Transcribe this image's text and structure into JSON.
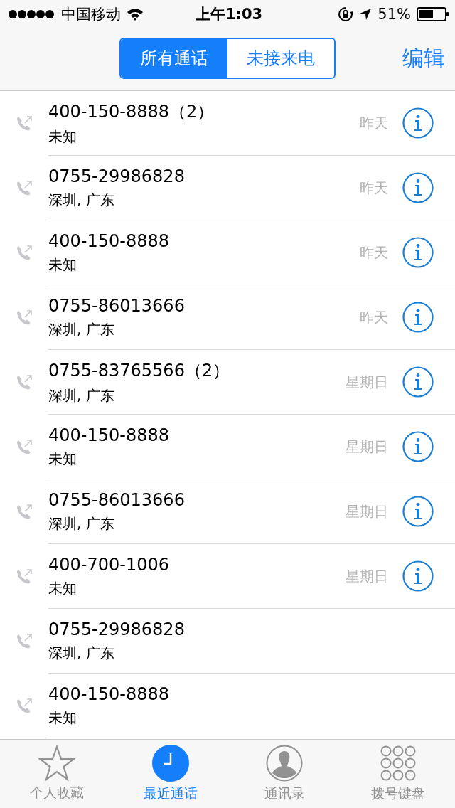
{
  "status_bar": {
    "carrier": "中国移动",
    "time": "上午1:03",
    "battery": "51%"
  },
  "nav": {
    "segments": [
      {
        "label": "所有通话",
        "selected": true
      },
      {
        "label": "未接来电",
        "selected": false
      }
    ],
    "edit": "编辑"
  },
  "calls": [
    {
      "number": "400-150-8888（2）",
      "location": "未知",
      "date": "昨天"
    },
    {
      "number": "0755-29986828",
      "location": "深圳, 广东",
      "date": "昨天"
    },
    {
      "number": "400-150-8888",
      "location": "未知",
      "date": "昨天"
    },
    {
      "number": "0755-86013666",
      "location": "深圳, 广东",
      "date": "昨天"
    },
    {
      "number": "0755-83765566（2）",
      "location": "深圳, 广东",
      "date": "星期日"
    },
    {
      "number": "400-150-8888",
      "location": "未知",
      "date": "星期日"
    },
    {
      "number": "0755-86013666",
      "location": "深圳, 广东",
      "date": "星期日"
    },
    {
      "number": "400-700-1006",
      "location": "未知",
      "date": "星期日"
    },
    {
      "number": "0755-29986828",
      "location": "深圳, 广东"
    },
    {
      "number": "400-150-8888",
      "location": "未知"
    }
  ],
  "tab_bar": [
    {
      "label": "个人收藏",
      "selected": false
    },
    {
      "label": "最近通话",
      "selected": true
    },
    {
      "label": "通讯录",
      "selected": false
    },
    {
      "label": "拨号键盘",
      "selected": false
    }
  ]
}
